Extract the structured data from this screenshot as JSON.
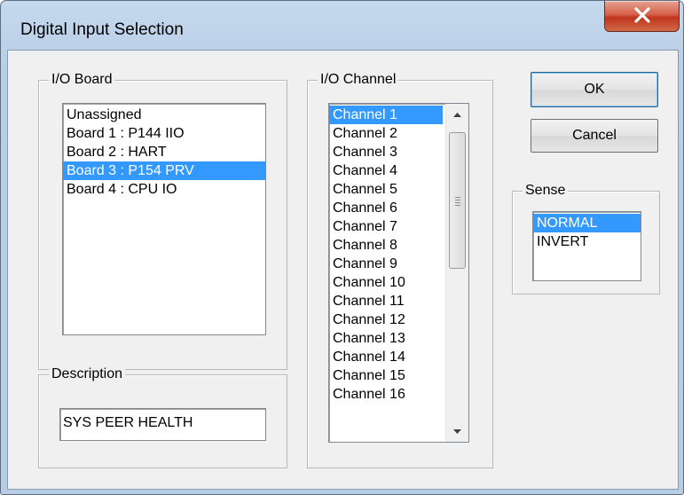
{
  "window": {
    "title": "Digital Input Selection"
  },
  "io_board": {
    "label": "I/O Board",
    "items": [
      "Unassigned",
      "Board 1 : P144 IIO",
      "Board 2 : HART",
      "Board 3 : P154 PRV",
      "Board 4 : CPU IO"
    ],
    "selected_index": 3
  },
  "io_channel": {
    "label": "I/O Channel",
    "items": [
      "Channel 1",
      "Channel 2",
      "Channel 3",
      "Channel 4",
      "Channel 5",
      "Channel 6",
      "Channel 7",
      "Channel 8",
      "Channel 9",
      "Channel 10",
      "Channel 11",
      "Channel 12",
      "Channel 13",
      "Channel 14",
      "Channel 15",
      "Channel 16"
    ],
    "selected_index": 0
  },
  "description": {
    "label": "Description",
    "value": "SYS PEER HEALTH"
  },
  "buttons": {
    "ok": "OK",
    "cancel": "Cancel"
  },
  "sense": {
    "label": "Sense",
    "items": [
      "NORMAL",
      "INVERT"
    ],
    "selected_index": 0
  },
  "colors": {
    "selection": "#3399ff",
    "close_button": "#c7432c",
    "dialog_face": "#f0f0f0"
  }
}
